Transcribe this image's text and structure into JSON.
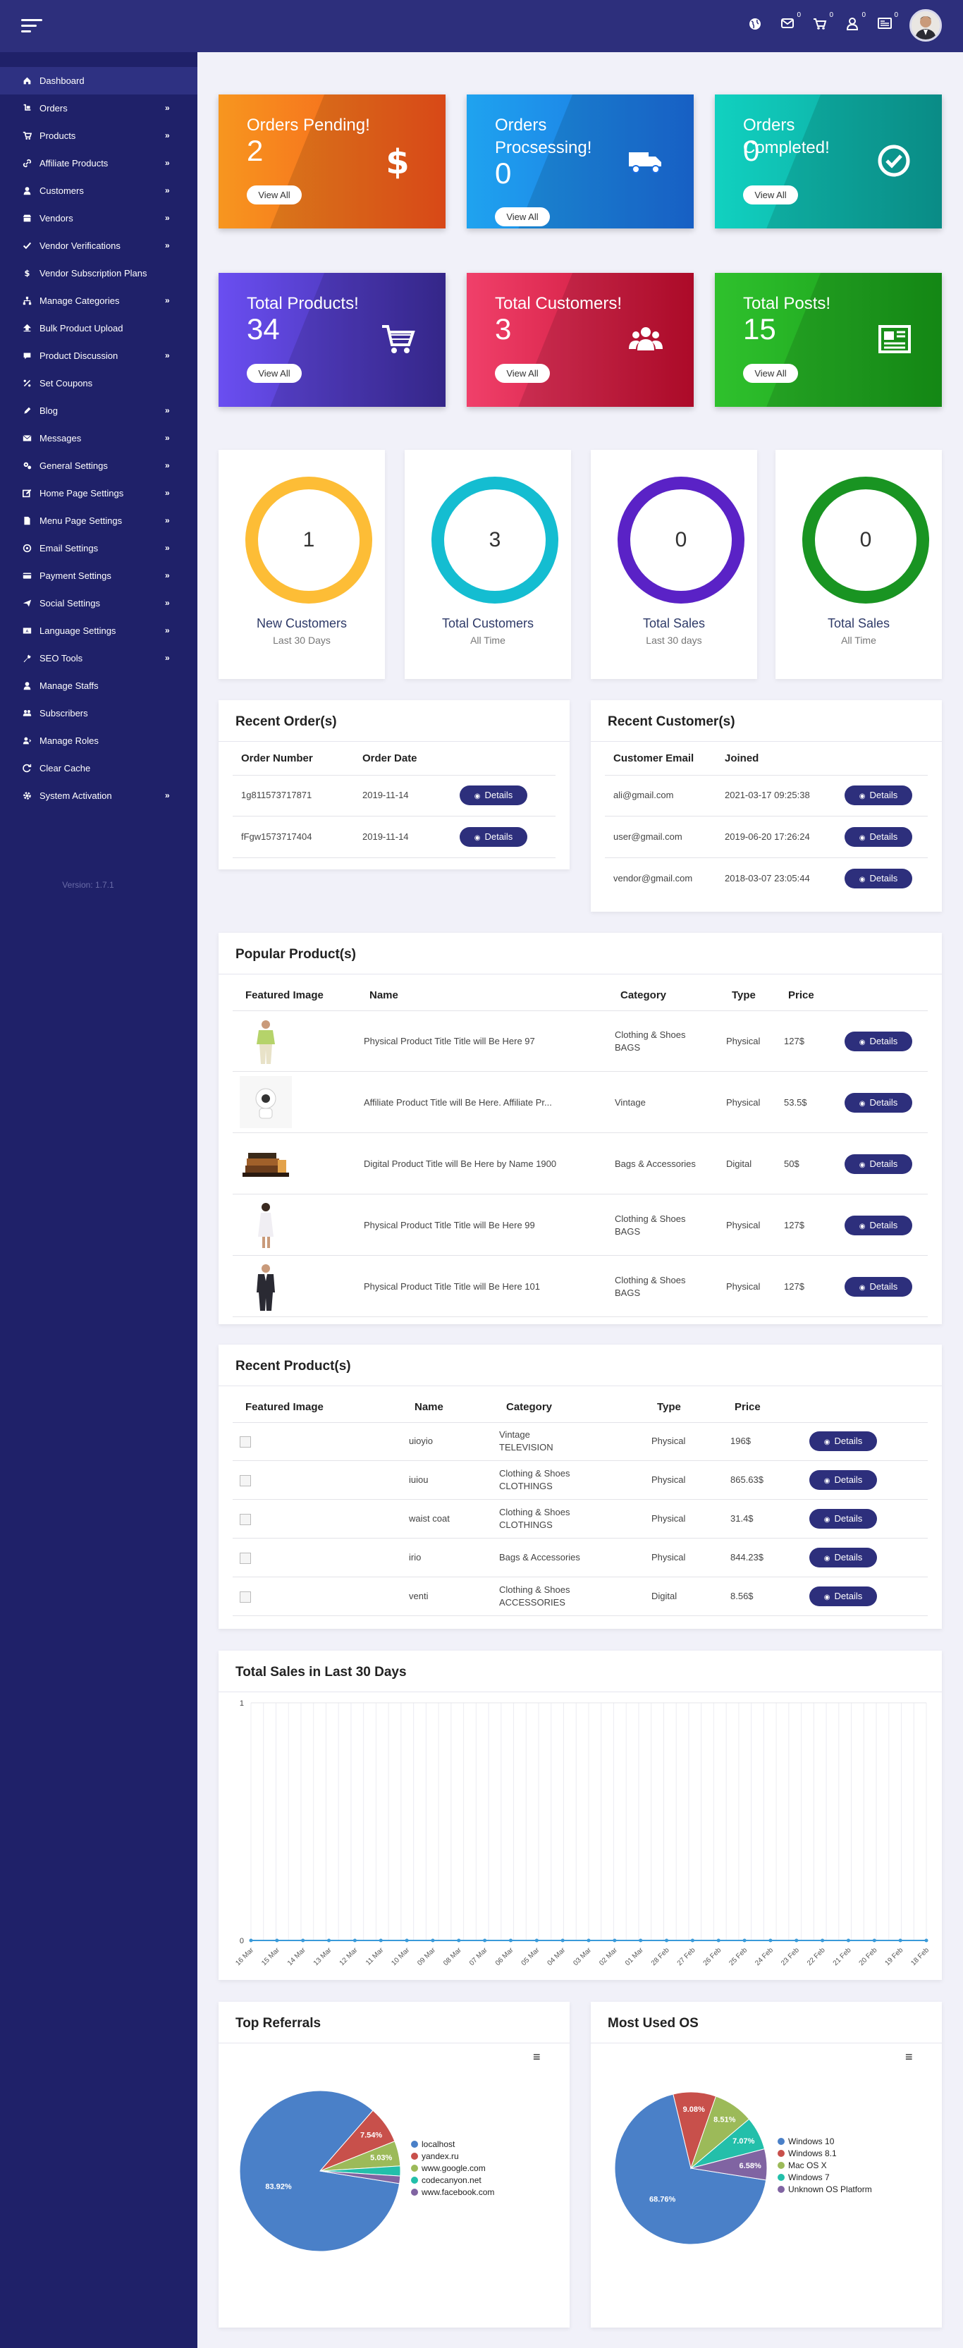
{
  "header": {
    "icons": [
      {
        "name": "globe-icon",
        "count": ""
      },
      {
        "name": "envelope-icon",
        "count": "0"
      },
      {
        "name": "cart-icon",
        "count": "0"
      },
      {
        "name": "user-icon",
        "count": "0"
      },
      {
        "name": "newspaper-icon",
        "count": "0"
      }
    ]
  },
  "sidebar": {
    "items": [
      {
        "label": "Dashboard",
        "icon": "home-icon",
        "arrow": false,
        "active": true
      },
      {
        "label": "Orders",
        "icon": "hand-cart-icon",
        "arrow": true
      },
      {
        "label": "Products",
        "icon": "cart-icon",
        "arrow": true
      },
      {
        "label": "Affiliate Products",
        "icon": "link-icon",
        "arrow": true
      },
      {
        "label": "Customers",
        "icon": "user-icon",
        "arrow": true
      },
      {
        "label": "Vendors",
        "icon": "store-icon",
        "arrow": true
      },
      {
        "label": "Vendor Verifications",
        "icon": "check-icon",
        "arrow": true
      },
      {
        "label": "Vendor Subscription Plans",
        "icon": "dollar-icon",
        "arrow": false
      },
      {
        "label": "Manage Categories",
        "icon": "sitemap-icon",
        "arrow": true
      },
      {
        "label": "Bulk Product Upload",
        "icon": "upload-icon",
        "arrow": false
      },
      {
        "label": "Product Discussion",
        "icon": "comment-icon",
        "arrow": true
      },
      {
        "label": "Set Coupons",
        "icon": "percent-icon",
        "arrow": false
      },
      {
        "label": "Blog",
        "icon": "pen-icon",
        "arrow": true
      },
      {
        "label": "Messages",
        "icon": "envelope-icon",
        "arrow": true
      },
      {
        "label": "General Settings",
        "icon": "cogs-icon",
        "arrow": true
      },
      {
        "label": "Home Page Settings",
        "icon": "edit-icon",
        "arrow": true
      },
      {
        "label": "Menu Page Settings",
        "icon": "file-icon",
        "arrow": true
      },
      {
        "label": "Email Settings",
        "icon": "at-icon",
        "arrow": true
      },
      {
        "label": "Payment Settings",
        "icon": "card-icon",
        "arrow": true
      },
      {
        "label": "Social Settings",
        "icon": "paper-plane-icon",
        "arrow": true
      },
      {
        "label": "Language Settings",
        "icon": "language-icon",
        "arrow": true
      },
      {
        "label": "SEO Tools",
        "icon": "wrench-icon",
        "arrow": true
      },
      {
        "label": "Manage Staffs",
        "icon": "staff-icon",
        "arrow": false
      },
      {
        "label": "Subscribers",
        "icon": "users-icon",
        "arrow": false
      },
      {
        "label": "Manage Roles",
        "icon": "roles-icon",
        "arrow": false
      },
      {
        "label": "Clear Cache",
        "icon": "sync-icon",
        "arrow": false
      },
      {
        "label": "System Activation",
        "icon": "gear-icon",
        "arrow": true
      }
    ],
    "version": "Version: 1.7.1"
  },
  "stat_cards": [
    {
      "title": "Orders Pending!",
      "value": "2",
      "button": "View All",
      "icon": "dollar-icon",
      "from": "#f7961f",
      "to": "#f6531b"
    },
    {
      "title": "Orders Procsessing!",
      "value": "0",
      "button": "View All",
      "icon": "truck-icon",
      "from": "#1fa3ef",
      "to": "#1b6de0"
    },
    {
      "title": "Orders Completed!",
      "value": "0",
      "button": "View All",
      "icon": "check-circle-icon",
      "from": "#11d1c0",
      "to": "#0c9f99"
    },
    {
      "title": "Total Products!",
      "value": "34",
      "button": "View All",
      "icon": "cart-icon",
      "from": "#6a4ef1",
      "to": "#3c2c9c"
    },
    {
      "title": "Total Customers!",
      "value": "3",
      "button": "View All",
      "icon": "users-icon",
      "from": "#f0406a",
      "to": "#c40c2e"
    },
    {
      "title": "Total Posts!",
      "value": "15",
      "button": "View All",
      "icon": "newspaper-icon",
      "from": "#2fc12d",
      "to": "#179a18"
    }
  ],
  "rings": [
    {
      "value": "1",
      "title": "New Customers",
      "subtitle": "Last 30 Days",
      "color": "#fdbd36"
    },
    {
      "value": "3",
      "title": "Total Customers",
      "subtitle": "All Time",
      "color": "#14bdd1"
    },
    {
      "value": "0",
      "title": "Total Sales",
      "subtitle": "Last 30 days",
      "color": "#5a22c6"
    },
    {
      "value": "0",
      "title": "Total Sales",
      "subtitle": "All Time",
      "color": "#199422"
    }
  ],
  "recent_orders": {
    "title": "Recent Order(s)",
    "headers": [
      "Order Number",
      "Order Date"
    ],
    "rows": [
      {
        "number": "1g811573717871",
        "date": "2019-11-14",
        "button": "Details"
      },
      {
        "number": "fFgw1573717404",
        "date": "2019-11-14",
        "button": "Details"
      }
    ]
  },
  "recent_customers": {
    "title": "Recent Customer(s)",
    "headers": [
      "Customer Email",
      "Joined"
    ],
    "rows": [
      {
        "email": "ali@gmail.com",
        "joined": "2021-03-17 09:25:38",
        "button": "Details"
      },
      {
        "email": "user@gmail.com",
        "joined": "2019-06-20 17:26:24",
        "button": "Details"
      },
      {
        "email": "vendor@gmail.com",
        "joined": "2018-03-07 23:05:44",
        "button": "Details"
      }
    ]
  },
  "popular_products": {
    "title": "Popular Product(s)",
    "headers": [
      "Featured Image",
      "Name",
      "Category",
      "Type",
      "Price"
    ],
    "rows": [
      {
        "image": "man-in-green-shirt",
        "name": "Physical Product Title Title will Be Here 97",
        "category": [
          "Clothing & Shoes",
          "BAGS"
        ],
        "type": "Physical",
        "price": "127$",
        "button": "Details"
      },
      {
        "image": "security-camera",
        "name": "Affiliate Product Title will Be Here. Affiliate Pr...",
        "category": [
          "Vintage"
        ],
        "type": "Physical",
        "price": "53.5$",
        "button": "Details"
      },
      {
        "image": "books-and-coffee",
        "name": "Digital Product Title will Be Here by Name 1900",
        "category": [
          "Bags & Accessories"
        ],
        "type": "Digital",
        "price": "50$",
        "button": "Details"
      },
      {
        "image": "woman-in-white",
        "name": "Physical Product Title Title will Be Here 99",
        "category": [
          "Clothing & Shoes",
          "BAGS"
        ],
        "type": "Physical",
        "price": "127$",
        "button": "Details"
      },
      {
        "image": "man-in-suit",
        "name": "Physical Product Title Title will Be Here 101",
        "category": [
          "Clothing & Shoes",
          "BAGS"
        ],
        "type": "Physical",
        "price": "127$",
        "button": "Details"
      }
    ]
  },
  "recent_products": {
    "title": "Recent Product(s)",
    "headers": [
      "Featured Image",
      "Name",
      "Category",
      "Type",
      "Price"
    ],
    "rows": [
      {
        "name": "uioyio",
        "category": [
          "Vintage",
          "TELEVISION"
        ],
        "type": "Physical",
        "price": "196$",
        "button": "Details"
      },
      {
        "name": "iuiou",
        "category": [
          "Clothing & Shoes",
          "CLOTHINGS"
        ],
        "type": "Physical",
        "price": "865.63$",
        "button": "Details"
      },
      {
        "name": "waist coat",
        "category": [
          "Clothing & Shoes",
          "CLOTHINGS"
        ],
        "type": "Physical",
        "price": "31.4$",
        "button": "Details"
      },
      {
        "name": "irio",
        "category": [
          "Bags & Accessories"
        ],
        "type": "Physical",
        "price": "844.23$",
        "button": "Details"
      },
      {
        "name": "venti",
        "category": [
          "Clothing & Shoes",
          "ACCESSORIES"
        ],
        "type": "Digital",
        "price": "8.56$",
        "button": "Details"
      }
    ]
  },
  "chart_data": [
    {
      "type": "line",
      "title": "Total Sales in Last 30 Days",
      "x": [
        "16 Mar",
        "15 Mar",
        "14 Mar",
        "13 Mar",
        "12 Mar",
        "11 Mar",
        "10 Mar",
        "09 Mar",
        "08 Mar",
        "07 Mar",
        "06 Mar",
        "05 Mar",
        "04 Mar",
        "03 Mar",
        "02 Mar",
        "01 Mar",
        "28 Feb",
        "27 Feb",
        "26 Feb",
        "25 Feb",
        "24 Feb",
        "23 Feb",
        "22 Feb",
        "21 Feb",
        "20 Feb",
        "19 Feb",
        "18 Feb"
      ],
      "series": [
        {
          "values": [
            0,
            0,
            0,
            0,
            0,
            0,
            0,
            0,
            0,
            0,
            0,
            0,
            0,
            0,
            0,
            0,
            0,
            0,
            0,
            0,
            0,
            0,
            0,
            0,
            0,
            0,
            0
          ]
        }
      ],
      "ylim": [
        0,
        1
      ],
      "yticks": [
        "0",
        "1"
      ],
      "grid": true,
      "color": "#3a9ad9"
    },
    {
      "type": "pie",
      "title": "Top Referrals",
      "labels": [
        "localhost",
        "yandex.ru",
        "www.google.com",
        "codecanyon.net",
        "www.facebook.com"
      ],
      "values": [
        83.92,
        7.54,
        5.03,
        2.0,
        1.51
      ],
      "value_labels": [
        "83.92%",
        "7.54%",
        "5.03%",
        "",
        ""
      ],
      "colors": [
        "#4a80c8",
        "#c8504b",
        "#9cba59",
        "#23bfaa",
        "#8064a2"
      ],
      "legend": "right"
    },
    {
      "type": "pie",
      "title": "Most Used OS",
      "labels": [
        "Windows 10",
        "Windows 8.1",
        "Mac OS X",
        "Windows 7",
        "Unknown OS Platform"
      ],
      "values": [
        68.76,
        9.08,
        8.51,
        7.07,
        6.58
      ],
      "value_labels": [
        "68.76%",
        "9.08%",
        "8.51%",
        "7.07%",
        "6.58%"
      ],
      "colors": [
        "#4a80c8",
        "#c8504b",
        "#9cba59",
        "#23bfaa",
        "#8064a2"
      ],
      "legend": "right"
    }
  ],
  "chart_menu_icon": "hamburger-menu-icon"
}
